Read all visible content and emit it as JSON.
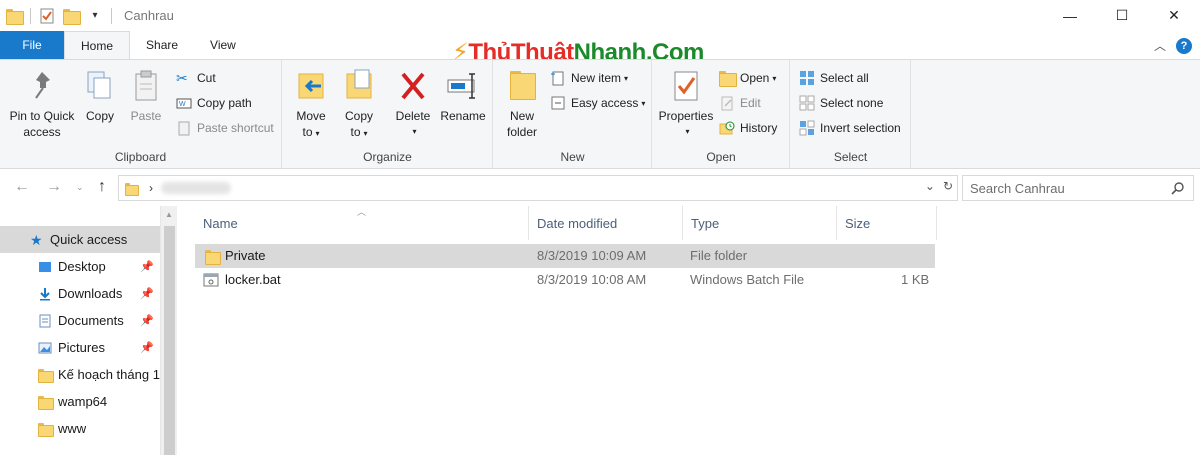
{
  "window": {
    "title": "Canhrau"
  },
  "quick_access_toolbar": {
    "icons": [
      "folder-icon",
      "properties-checkmark-icon",
      "new-folder-icon",
      "customize-dropdown-icon"
    ]
  },
  "window_controls": {
    "minimize": "—",
    "maximize": "☐",
    "close": "✕"
  },
  "ribbon_tabs": [
    {
      "label": "File"
    },
    {
      "label": "Home"
    },
    {
      "label": "Share"
    },
    {
      "label": "View"
    }
  ],
  "watermark": {
    "part1": "ThủThuật",
    "part2": "Nhanh.Com"
  },
  "ribbon": {
    "clipboard": {
      "label": "Clipboard",
      "pin_label_1": "Pin to Quick",
      "pin_label_2": "access",
      "copy": "Copy",
      "paste": "Paste",
      "cut": "Cut",
      "copy_path": "Copy path",
      "paste_shortcut": "Paste shortcut"
    },
    "organize": {
      "label": "Organize",
      "move_to_1": "Move",
      "move_to_2": "to",
      "copy_to_1": "Copy",
      "copy_to_2": "to",
      "delete": "Delete",
      "rename": "Rename"
    },
    "new": {
      "label": "New",
      "new_folder_1": "New",
      "new_folder_2": "folder",
      "new_item": "New item",
      "easy_access": "Easy access"
    },
    "open": {
      "label": "Open",
      "properties": "Properties",
      "open": "Open",
      "edit": "Edit",
      "history": "History"
    },
    "select": {
      "label": "Select",
      "select_all": "Select all",
      "select_none": "Select none",
      "invert_selection": "Invert selection"
    }
  },
  "search": {
    "placeholder": "Search Canhrau"
  },
  "nav_pane": {
    "items": [
      {
        "label": "Quick access",
        "pinned": false
      },
      {
        "label": "Desktop",
        "pinned": true
      },
      {
        "label": "Downloads",
        "pinned": true
      },
      {
        "label": "Documents",
        "pinned": true
      },
      {
        "label": "Pictures",
        "pinned": true
      },
      {
        "label": "Kế hoạch tháng 1",
        "pinned": false
      },
      {
        "label": "wamp64",
        "pinned": false
      },
      {
        "label": "www",
        "pinned": false
      }
    ]
  },
  "file_list": {
    "columns": [
      "Name",
      "Date modified",
      "Type",
      "Size"
    ],
    "rows": [
      {
        "name": "Private",
        "date": "8/3/2019 10:09 AM",
        "type": "File folder",
        "size": "",
        "selected": true
      },
      {
        "name": "locker.bat",
        "date": "8/3/2019 10:08 AM",
        "type": "Windows Batch File",
        "size": "1 KB",
        "selected": false
      }
    ]
  },
  "colors": {
    "file_tab": "#1979ca",
    "selection": "#d9d9d9",
    "column_header_text": "#4c607a"
  }
}
